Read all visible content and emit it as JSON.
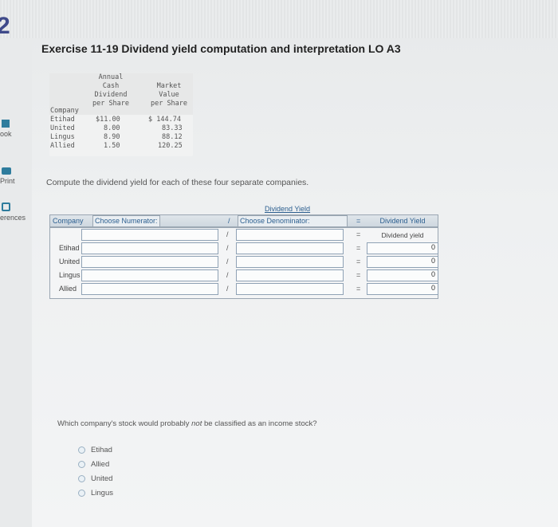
{
  "corner_number": "2",
  "title": "Exercise 11-19 Dividend yield computation and interpretation LO A3",
  "left_rail": {
    "book": "ook",
    "print": "Print",
    "references": "erences"
  },
  "data_table": {
    "headers": {
      "company": "Company",
      "dividend": [
        "Annual",
        "Cash",
        "Dividend",
        "per Share"
      ],
      "market": [
        "Market",
        "Value",
        "per Share"
      ]
    },
    "rows": [
      {
        "company": "Etihad",
        "dividend": "$11.00",
        "market": "$ 144.74"
      },
      {
        "company": "United",
        "dividend": "8.00",
        "market": "83.33"
      },
      {
        "company": "Lingus",
        "dividend": "8.90",
        "market": "88.12"
      },
      {
        "company": "Allied",
        "dividend": "1.50",
        "market": "120.25"
      }
    ]
  },
  "instruction": "Compute the dividend yield for each of these four separate companies.",
  "work_table": {
    "dividend_yield_header": "Dividend Yield",
    "company_header": "Company",
    "numerator_header": "Choose Numerator:",
    "slash": "/",
    "denominator_header": "Choose Denominator:",
    "equals": "=",
    "result_header": "Dividend Yield",
    "result_sub": "Dividend yield",
    "rows": [
      {
        "company": "",
        "result": ""
      },
      {
        "company": "Etihad",
        "result": "0"
      },
      {
        "company": "United",
        "result": "0"
      },
      {
        "company": "Lingus",
        "result": "0"
      },
      {
        "company": "Allied",
        "result": "0"
      }
    ]
  },
  "question": {
    "before": "Which company's stock would probably ",
    "emphasis": "not",
    "after": " be classified as an income stock?"
  },
  "options": [
    "Etihad",
    "Allied",
    "United",
    "Lingus"
  ]
}
